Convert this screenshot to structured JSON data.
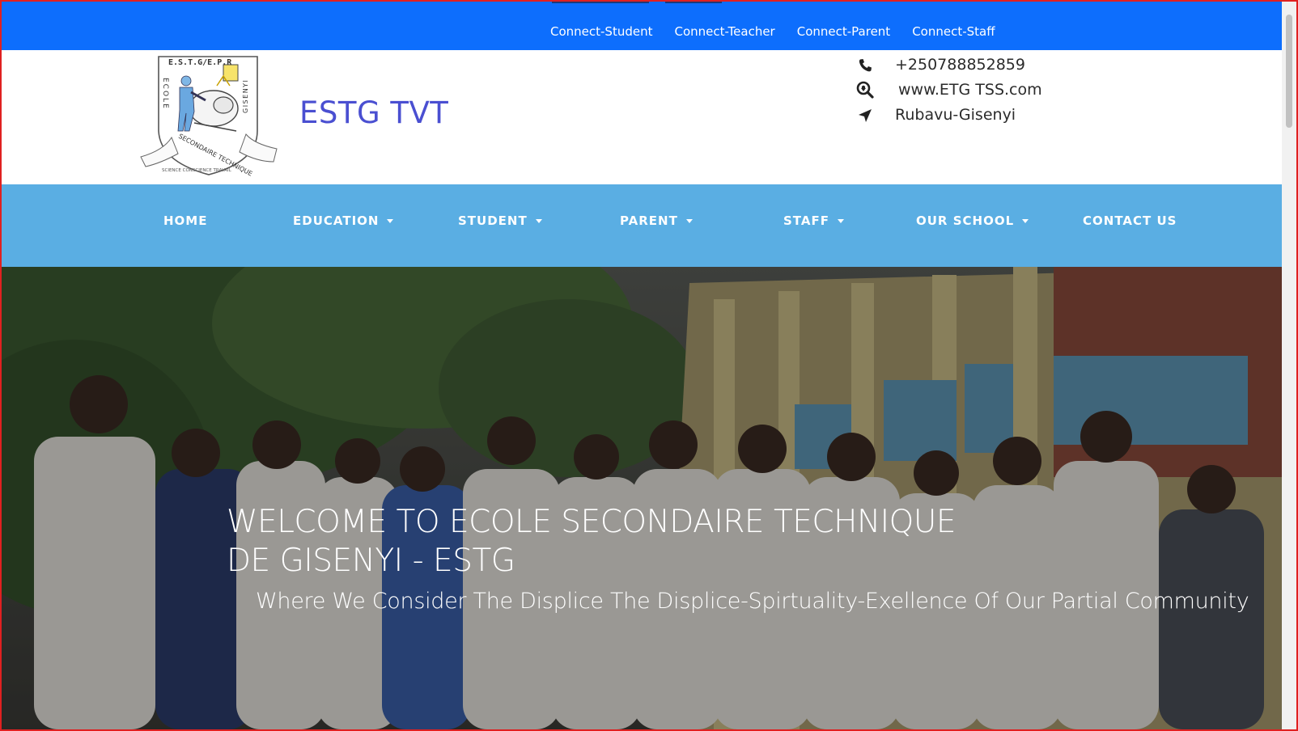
{
  "topbar": {
    "links": [
      "Connect-Student",
      "Connect-Teacher",
      "Connect-Parent",
      "Connect-Staff"
    ]
  },
  "header": {
    "logo": {
      "top_text": "E.S.T.G/E.P.R",
      "left_text": "ECOLE",
      "right_text": "GISENYI",
      "arc_text": "SECONDAIRE TECHNIQUE",
      "motto": "SCIENCE CONSCIENCE TRAVAIL"
    },
    "brand": "ESTG TVT",
    "contact": {
      "phone": "+250788852859",
      "website": "www.ETG TSS.com",
      "location": "Rubavu-Gisenyi"
    }
  },
  "nav": {
    "home": "HOME",
    "education": "EDUCATION",
    "student": "STUDENT",
    "parent": "PARENT",
    "staff": "STAFF",
    "our_school": "OUR SCHOOL",
    "contact_us": "CONTACT US"
  },
  "hero": {
    "title": "WELCOME TO ECOLE SECONDAIRE TECHNIQUE DE GISENYI - ESTG",
    "subtitle": "Where We Consider The Displice The Displice-Spirtuality-Exellence Of Our Partial Community"
  },
  "colors": {
    "topbar": "#0d6efd",
    "nav": "#5aaee3",
    "brand": "#4a4fd1",
    "frame": "#e02020"
  }
}
